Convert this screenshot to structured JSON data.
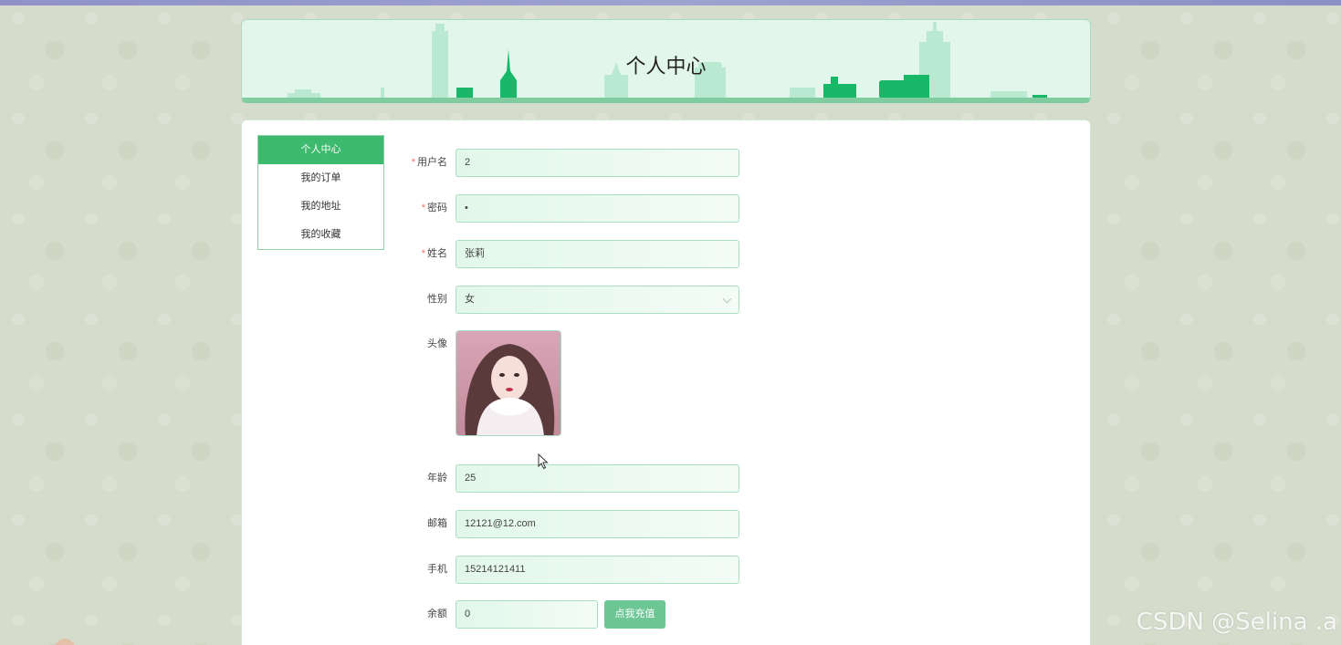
{
  "header": {
    "title": "个人中心"
  },
  "menu": {
    "items": [
      {
        "label": "个人中心",
        "active": true
      },
      {
        "label": "我的订单",
        "active": false
      },
      {
        "label": "我的地址",
        "active": false
      },
      {
        "label": "我的收藏",
        "active": false
      }
    ]
  },
  "form": {
    "username": {
      "label": "用户名",
      "required": "*",
      "value": "2"
    },
    "password": {
      "label": "密码",
      "required": "*",
      "value": "•"
    },
    "name": {
      "label": "姓名",
      "required": "*",
      "value": "张莉"
    },
    "gender": {
      "label": "性别",
      "value": "女"
    },
    "avatar": {
      "label": "头像"
    },
    "age": {
      "label": "年龄",
      "value": "25"
    },
    "email": {
      "label": "邮箱",
      "value": "12121@12.com"
    },
    "phone": {
      "label": "手机",
      "value": "15214121411"
    },
    "balance": {
      "label": "余额",
      "value": "0",
      "button": "点我充值"
    }
  },
  "watermark": "CSDN @Selina .a",
  "colors": {
    "accent": "#3dba6e",
    "button": "#6cc795",
    "input_border": "#a9e0c0",
    "required": "#f56c6c"
  }
}
